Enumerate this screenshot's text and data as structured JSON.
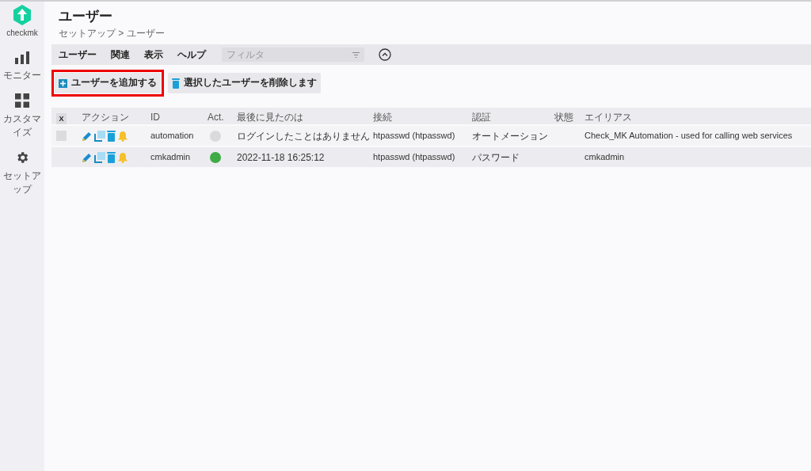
{
  "sidebar": {
    "logo": "checkmk",
    "items": [
      {
        "label": "モニター",
        "kind": "chart"
      },
      {
        "label": "カスタマイズ",
        "kind": "grid"
      },
      {
        "label": "セットアップ",
        "kind": "gear"
      }
    ]
  },
  "page": {
    "title": "ユーザー",
    "breadcrumb": "セットアップ > ユーザー"
  },
  "menu": {
    "items": [
      "ユーザー",
      "関連",
      "表示",
      "ヘルプ"
    ],
    "filter_placeholder": "フィルタ"
  },
  "actions": [
    {
      "label": "ユーザーを追加する",
      "kind": "add",
      "highlighted": true
    },
    {
      "label": "選択したユーザーを削除します",
      "kind": "delete",
      "highlighted": false
    }
  ],
  "table": {
    "toggle": "X",
    "columns": [
      "アクション",
      "ID",
      "Act.",
      "最後に見たのは",
      "接続",
      "認証",
      "状態",
      "エイリアス"
    ],
    "rows": [
      {
        "selectable": true,
        "checked": false,
        "id": "automation",
        "active": false,
        "last_seen": "ログインしたことはありません",
        "connection": "htpasswd (htpasswd)",
        "auth": "オートメーション",
        "alias": "Check_MK Automation - used for calling web services"
      },
      {
        "selectable": false,
        "id": "cmkadmin",
        "active": true,
        "last_seen": "2022-11-18 16:25:12",
        "connection": "htpasswd (htpasswd)",
        "auth": "パスワード",
        "alias": "cmkadmin"
      }
    ]
  }
}
